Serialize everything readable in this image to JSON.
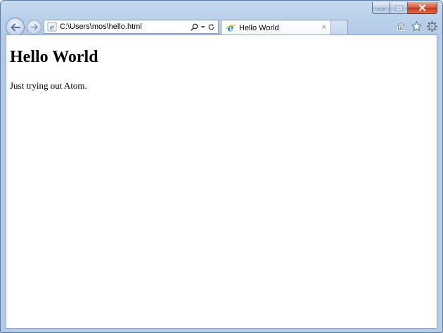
{
  "window": {
    "caption_buttons": [
      "minimize",
      "maximize",
      "close"
    ]
  },
  "navigation": {
    "back_icon": "back-arrow-icon",
    "forward_icon": "forward-arrow-icon"
  },
  "address_bar": {
    "url": "C:\\Users\\mos\\hello.html",
    "page_icon": "ie-page-icon",
    "tools": {
      "search_icon": "search-icon",
      "dropdown_icon": "dropdown-icon",
      "refresh_icon": "refresh-icon"
    }
  },
  "tabs": [
    {
      "label": "Hello World",
      "active": true,
      "close_glyph": "×"
    }
  ],
  "toolbar": {
    "icons": [
      "home-icon",
      "favorites-star-icon",
      "settings-gear-icon"
    ]
  },
  "page": {
    "heading": "Hello World",
    "paragraph": "Just trying out Atom."
  },
  "colors": {
    "chrome": "#b8cfe9",
    "close_button": "#c8442a",
    "viewport_bg": "#ffffff"
  }
}
